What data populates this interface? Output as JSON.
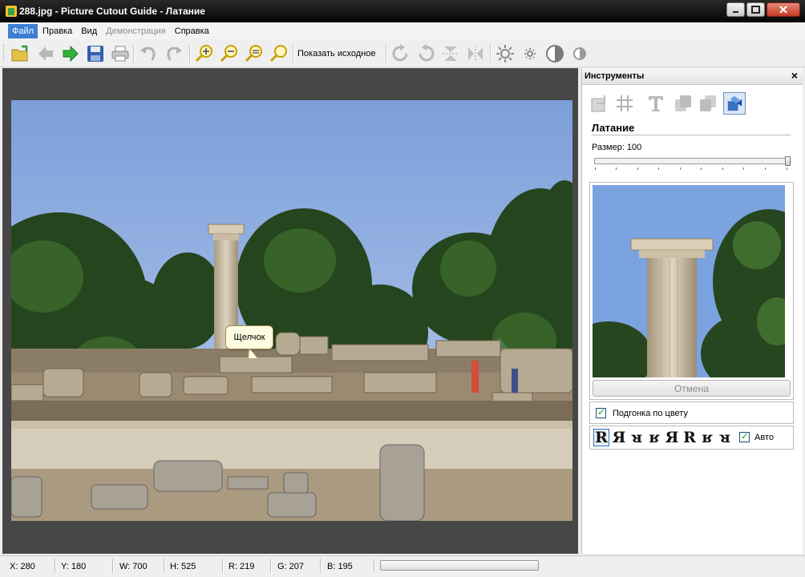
{
  "window": {
    "title": "288.jpg - Picture Cutout Guide - Латание"
  },
  "menu": [
    {
      "label": "Файл",
      "state": "active"
    },
    {
      "label": "Правка",
      "state": "normal"
    },
    {
      "label": "Вид",
      "state": "normal"
    },
    {
      "label": "Демонстрация",
      "state": "disabled"
    },
    {
      "label": "Справка",
      "state": "normal"
    }
  ],
  "toolbar": {
    "show_original_label": "Показать исходное",
    "icons": [
      "open-folder-icon",
      "back-arrow-icon",
      "forward-arrow-icon",
      "save-disk-icon",
      "print-icon",
      "undo-icon",
      "redo-icon",
      "zoom-in-icon",
      "zoom-out-icon",
      "zoom-fit-icon",
      "zoom-actual-icon",
      "rotate-right-icon",
      "rotate-left-icon",
      "flip-vertical-icon",
      "flip-horizontal-icon",
      "brightness-up-icon",
      "brightness-down-icon",
      "contrast-up-icon",
      "contrast-down-icon"
    ]
  },
  "canvas": {
    "tooltip_text": "Щелчок"
  },
  "panel": {
    "title": "Инструменты",
    "close_glyph": "×",
    "section_title": "Латание",
    "size_label": "Размер: 100",
    "size_value": 100,
    "cancel_label": "Отмена",
    "fit_color_label": "Подгонка по цвету",
    "fit_color_checked": true,
    "orientations": [
      "R",
      "Я",
      "ᴚ",
      "ʁ",
      "Я",
      "R",
      "ʁ",
      "ᴚ"
    ],
    "auto_label": "Авто",
    "auto_checked": true
  },
  "status": {
    "x": "X: 280",
    "y": "Y: 180",
    "w": "W: 700",
    "h": "H: 525",
    "r": "R: 219",
    "g": "G: 207",
    "b": "B: 195"
  },
  "colors": {
    "accent": "#3b7fd6",
    "title_bar": "#0a0a0a",
    "canvas_bg": "#474747",
    "sky": "#8fb0e0"
  }
}
